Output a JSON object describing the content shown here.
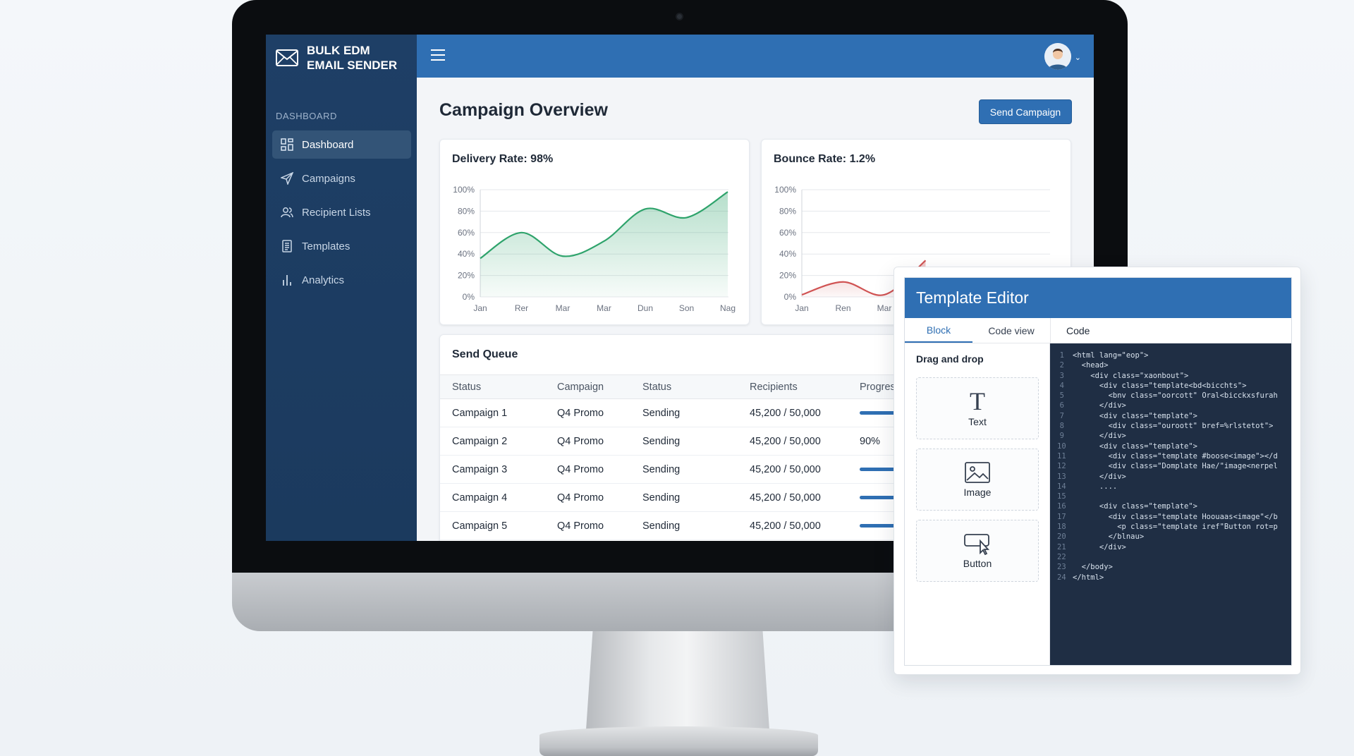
{
  "app": {
    "brand_line1": "BULK EDM",
    "brand_line2": "EMAIL SENDER"
  },
  "sidebar": {
    "section_label": "DASHBOARD",
    "items": [
      {
        "label": "Dashboard",
        "icon": "grid-icon",
        "active": true
      },
      {
        "label": "Campaigns",
        "icon": "paper-plane-icon",
        "active": false
      },
      {
        "label": "Recipient Lists",
        "icon": "users-icon",
        "active": false
      },
      {
        "label": "Templates",
        "icon": "document-icon",
        "active": false
      },
      {
        "label": "Analytics",
        "icon": "bar-chart-icon",
        "active": false
      }
    ]
  },
  "header": {
    "menu_icon": "hamburger-icon",
    "avatar_icon": "user-avatar-icon",
    "caret": "⌄"
  },
  "main": {
    "title": "Campaign Overview",
    "send_button": "Send Campaign"
  },
  "chart_data": [
    {
      "type": "area",
      "title": "Delivery Rate: 98%",
      "x": [
        "Jan",
        "Rer",
        "Mar",
        "Mar",
        "Dun",
        "Son",
        "Nag"
      ],
      "series": [
        {
          "values": [
            36,
            60,
            38,
            52,
            82,
            74,
            98
          ]
        }
      ],
      "ylim": [
        0,
        100
      ],
      "yticks": [
        "100%",
        "80%",
        "60%",
        "40%",
        "20%",
        "0%"
      ],
      "color": "#2ea36b",
      "grid": true
    },
    {
      "type": "area",
      "title": "Bounce Rate: 1.2%",
      "x": [
        "Jan",
        "Ren",
        "Mar"
      ],
      "series": [
        {
          "values": [
            2,
            14,
            2,
            34
          ]
        }
      ],
      "ylim": [
        0,
        100
      ],
      "yticks": [
        "100%",
        "80%",
        "60%",
        "40%",
        "20%",
        "0%"
      ],
      "color": "#d05353",
      "grid": true
    }
  ],
  "queue": {
    "title": "Send Queue",
    "columns": [
      "Status",
      "Campaign",
      "Status",
      "Recipients",
      "Progres"
    ],
    "rows": [
      {
        "name": "Campaign 1",
        "campaign": "Q4 Promo",
        "status": "Sending",
        "recipients": "45,200 / 50,000",
        "progress_label": "",
        "progress": 0.9
      },
      {
        "name": "Campaign 2",
        "campaign": "Q4 Promo",
        "status": "Sending",
        "recipients": "45,200 / 50,000",
        "progress_label": "90%",
        "progress": 0.9
      },
      {
        "name": "Campaign 3",
        "campaign": "Q4 Promo",
        "status": "Sending",
        "recipients": "45,200 / 50,000",
        "progress_label": "",
        "progress": 0.9
      },
      {
        "name": "Campaign 4",
        "campaign": "Q4 Promo",
        "status": "Sending",
        "recipients": "45,200 / 50,000",
        "progress_label": "",
        "progress": 0.9
      },
      {
        "name": "Campaign 5",
        "campaign": "Q4 Promo",
        "status": "Sending",
        "recipients": "45,200 / 50,000",
        "progress_label": "",
        "progress": 0.9
      }
    ]
  },
  "editor": {
    "title": "Template Editor",
    "tabs": [
      "Block",
      "Code view"
    ],
    "active_tab": "Block",
    "code_tab": "Code",
    "palette_title": "Drag and drop",
    "blocks": [
      {
        "label": "Text",
        "icon": "text-icon"
      },
      {
        "label": "Image",
        "icon": "image-icon"
      },
      {
        "label": "Button",
        "icon": "button-cursor-icon"
      }
    ],
    "code_lines": [
      {
        "n": "1",
        "t": "<html lang=\"eop\">"
      },
      {
        "n": "2",
        "t": "  <head>"
      },
      {
        "n": "3",
        "t": "    <div class=\"xaonbout\">"
      },
      {
        "n": "4",
        "t": "      <div class=\"template<bd<bicchts\">"
      },
      {
        "n": "5",
        "t": "        <bnv class=\"oorcott\" Oral<bicckxsfurah"
      },
      {
        "n": "6",
        "t": "      </div>"
      },
      {
        "n": "7",
        "t": "      <div class=\"template\">"
      },
      {
        "n": "8",
        "t": "        <div class=\"ouroott\" bref=%rlstetot\">"
      },
      {
        "n": "9",
        "t": "      </div>"
      },
      {
        "n": "10",
        "t": "      <div class=\"template\">"
      },
      {
        "n": "11",
        "t": "        <div class=\"template #boose<image\"></d"
      },
      {
        "n": "12",
        "t": "        <div class=\"Domplate Hae/\"image<nerpel"
      },
      {
        "n": "13",
        "t": "      </div>"
      },
      {
        "n": "14",
        "t": "      ...."
      },
      {
        "n": "15",
        "t": ""
      },
      {
        "n": "16",
        "t": "      <div class=\"template\">"
      },
      {
        "n": "17",
        "t": "        <div class=\"template Hoouaas<image\"</b"
      },
      {
        "n": "18",
        "t": "          <p class=\"template iref\"Button rot=p"
      },
      {
        "n": "20",
        "t": "        </blnau>"
      },
      {
        "n": "21",
        "t": "      </div>"
      },
      {
        "n": "22",
        "t": ""
      },
      {
        "n": "23",
        "t": "  </body>"
      },
      {
        "n": "24",
        "t": "</html>"
      }
    ]
  }
}
